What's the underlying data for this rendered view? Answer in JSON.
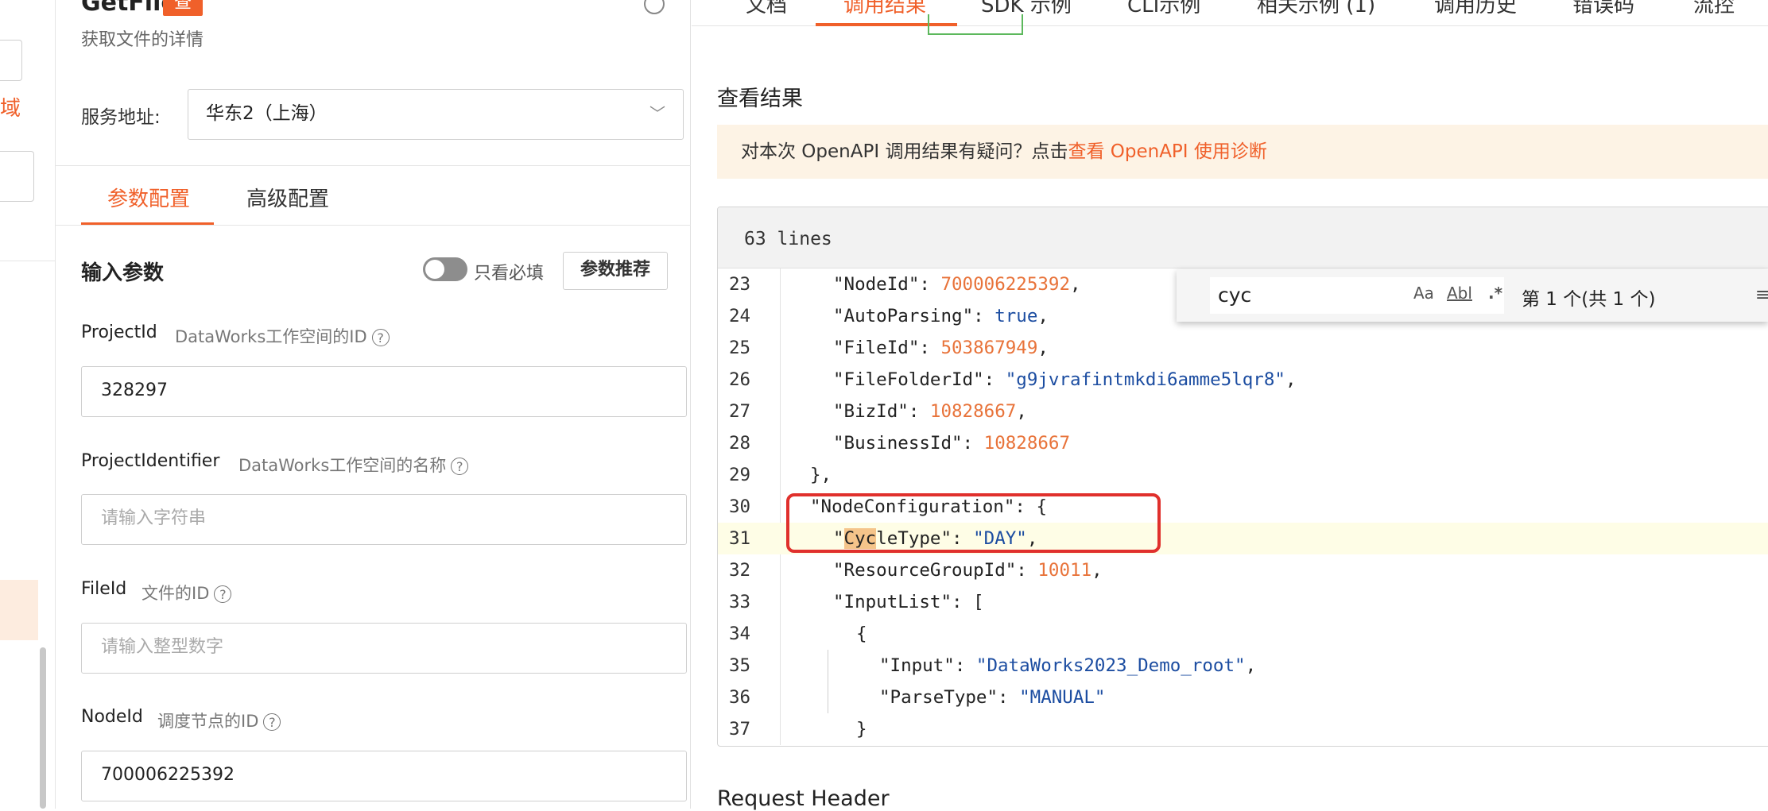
{
  "panel": {
    "title": "GetFile",
    "badge": "查",
    "subtitle": "获取文件的详情",
    "service_label": "服务地址:",
    "service_value": "华东2（上海）",
    "tabs": [
      {
        "label": "参数配置",
        "active": true
      },
      {
        "label": "高级配置",
        "active": false
      }
    ],
    "input_params_title": "输入参数",
    "required_only_label": "只看必填",
    "recommend_button": "参数推荐",
    "params": [
      {
        "name": "ProjectId",
        "desc": "DataWorks工作空间的ID",
        "value": "328297",
        "placeholder": ""
      },
      {
        "name": "ProjectIdentifier",
        "desc": "DataWorks工作空间的名称",
        "value": "",
        "placeholder": "请输入字符串"
      },
      {
        "name": "FileId",
        "desc": "文件的ID",
        "value": "",
        "placeholder": "请输入整型数字"
      },
      {
        "name": "NodeId",
        "desc": "调度节点的ID",
        "value": "700006225392",
        "placeholder": ""
      }
    ]
  },
  "left_strip": {
    "char": "域"
  },
  "right": {
    "tabs": [
      {
        "label": "文档",
        "active": false
      },
      {
        "label": "调用结果",
        "active": true
      },
      {
        "label": "SDK 示例",
        "active": false
      },
      {
        "label": "CLI示例",
        "active": false
      },
      {
        "label": "相关示例 (1)",
        "active": false
      },
      {
        "label": "调用历史",
        "active": false
      },
      {
        "label": "错误码",
        "active": false
      },
      {
        "label": "流控",
        "active": false
      }
    ],
    "section_title": "查看结果",
    "notice_text": "对本次 OpenAPI 调用结果有疑问？点击",
    "notice_link": "查看 OpenAPI 使用诊断",
    "code_header": "63 lines",
    "find": {
      "query": "cyc",
      "opt_case": "Aa",
      "opt_word": "Abl",
      "opt_regex": ".*",
      "count": "第 1 个(共 1 个)",
      "menu": "≡"
    },
    "code_lines": [
      {
        "n": "23",
        "indent": 3,
        "key": "NodeId",
        "val": "700006225392",
        "type": "num",
        "comma": true
      },
      {
        "n": "24",
        "indent": 3,
        "key": "AutoParsing",
        "val": "true",
        "type": "bool",
        "comma": true
      },
      {
        "n": "25",
        "indent": 3,
        "key": "FileId",
        "val": "503867949",
        "type": "num",
        "comma": true
      },
      {
        "n": "26",
        "indent": 3,
        "key": "FileFolderId",
        "val": "\"g9jvrafintmkdi6amme5lqr8\"",
        "type": "str",
        "comma": true
      },
      {
        "n": "27",
        "indent": 3,
        "key": "BizId",
        "val": "10828667",
        "type": "num",
        "comma": true
      },
      {
        "n": "28",
        "indent": 3,
        "key": "BusinessId",
        "val": "10828667",
        "type": "num",
        "comma": false
      },
      {
        "n": "29",
        "indent": 2,
        "raw": "},"
      },
      {
        "n": "30",
        "indent": 2,
        "key": "NodeConfiguration",
        "val": "{",
        "type": "punct",
        "comma": false
      },
      {
        "n": "31",
        "indent": 3,
        "key": "CycleType",
        "val": "\"DAY\"",
        "type": "str",
        "comma": true,
        "highlight": true
      },
      {
        "n": "32",
        "indent": 3,
        "key": "ResourceGroupId",
        "val": "10011",
        "type": "num",
        "comma": true
      },
      {
        "n": "33",
        "indent": 3,
        "key": "InputList",
        "val": "[",
        "type": "punct",
        "comma": false
      },
      {
        "n": "34",
        "indent": 4,
        "raw": "{"
      },
      {
        "n": "35",
        "indent": 5,
        "key": "Input",
        "val": "\"DataWorks2023_Demo_root\"",
        "type": "str",
        "comma": true
      },
      {
        "n": "36",
        "indent": 5,
        "key": "ParseType",
        "val": "\"MANUAL\"",
        "type": "str",
        "comma": false
      },
      {
        "n": "37",
        "indent": 4,
        "raw": "}"
      }
    ],
    "request_header_title": "Request Header"
  }
}
